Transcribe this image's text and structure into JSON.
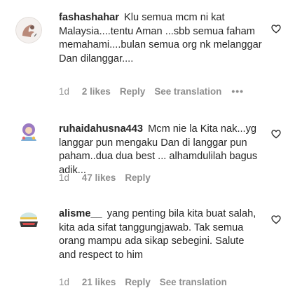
{
  "comments": [
    {
      "username": "fashashahar",
      "text": "Klu semua mcm ni kat Malaysia....tentu Aman ...sbb semua faham memahami....bulan semua org nk melanggar Dan dilanggar....",
      "time": "1d",
      "likes": "2 likes",
      "reply": "Reply",
      "translation": "See translation",
      "more": "•••",
      "avatar_icon": "user-avatar-icon",
      "like_icon": "heart-icon"
    },
    {
      "username": "ruhaidahusna443",
      "text": "Mcm nie la Kita nak...yg langgar pun mengaku Dan di langgar pun paham..dua dua best ... alhamdulilah bagus adik...",
      "time": "1d",
      "likes": "47 likes",
      "reply": "Reply",
      "avatar_icon": "user-avatar-icon",
      "like_icon": "heart-icon"
    },
    {
      "username": "alisme__",
      "text": "yang penting bila kita buat salah, kita ada sifat tanggungjawab. Tak semua orang mampu ada sikap sebegini. Salute and respect to him",
      "time": "1d",
      "likes": "21 likes",
      "reply": "Reply",
      "translation": "See translation",
      "avatar_icon": "user-avatar-icon",
      "like_icon": "heart-icon"
    }
  ]
}
